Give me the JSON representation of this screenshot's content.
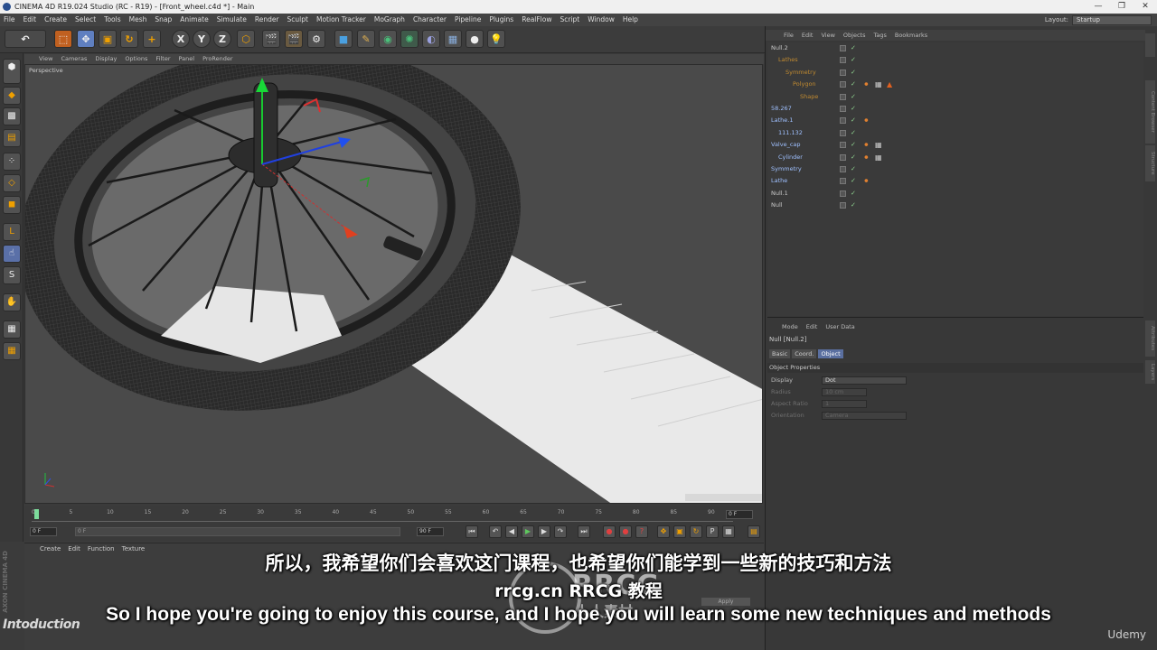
{
  "app": {
    "title": "CINEMA 4D R19.024 Studio (RC - R19) - [Front_wheel.c4d *] - Main",
    "window_controls": [
      "—",
      "❐",
      "✕"
    ]
  },
  "menubar": {
    "items": [
      "File",
      "Edit",
      "Create",
      "Select",
      "Tools",
      "Mesh",
      "Snap",
      "Animate",
      "Simulate",
      "Render",
      "Sculpt",
      "Motion Tracker",
      "MoGraph",
      "Character",
      "Pipeline",
      "Plugins",
      "RealFlow",
      "Script",
      "Window",
      "Help"
    ],
    "layout_label": "Layout:",
    "layout_value": "Startup"
  },
  "toolbar": {
    "axis_x": "X",
    "axis_y": "Y",
    "axis_z": "Z"
  },
  "viewport": {
    "menu": [
      "View",
      "Cameras",
      "Display",
      "Options",
      "Filter",
      "Panel",
      "ProRender"
    ],
    "label": "Perspective"
  },
  "timeline": {
    "ticks": [
      "0",
      "5",
      "10",
      "15",
      "20",
      "25",
      "30",
      "35",
      "40",
      "45",
      "50",
      "55",
      "60",
      "65",
      "70",
      "75",
      "80",
      "85",
      "90"
    ],
    "current_frame": "0 F",
    "start_field": "0 F",
    "end_field": "90 F",
    "range_end": "90 F",
    "range_start": "0 F"
  },
  "material_manager": {
    "menu": [
      "Create",
      "Edit",
      "Function",
      "Texture"
    ],
    "apply": "Apply"
  },
  "side_logo": "AXON CINEMA 4D",
  "intro_label": "Intoduction",
  "object_manager": {
    "menu": [
      "File",
      "Edit",
      "View",
      "Objects",
      "Tags",
      "Bookmarks"
    ],
    "objects": [
      {
        "name": "Null.2"
      },
      {
        "name": "Lathes"
      },
      {
        "name": "Symmetry"
      },
      {
        "name": "Polygon"
      },
      {
        "name": "Shape"
      },
      {
        "name": "58.267"
      },
      {
        "name": "Lathe.1"
      },
      {
        "name": "111.132"
      },
      {
        "name": "Valve_cap"
      },
      {
        "name": "Cylinder"
      },
      {
        "name": "Symmetry"
      },
      {
        "name": "Lathe"
      },
      {
        "name": "Null.1"
      },
      {
        "name": "Null"
      }
    ]
  },
  "attributes": {
    "menu": [
      "Mode",
      "Edit",
      "User Data"
    ],
    "title": "Null [Null.2]",
    "tabs": [
      "Basic",
      "Coord.",
      "Object"
    ],
    "section": "Object Properties",
    "props": [
      {
        "label": "Display",
        "value": "Dot"
      },
      {
        "label": "Radius",
        "value": "10 cm"
      },
      {
        "label": "Aspect Ratio",
        "value": "1"
      },
      {
        "label": "Orientation",
        "value": "Camera"
      }
    ],
    "side_tabs": [
      "Attributes",
      "Layers"
    ]
  },
  "right_side_tabs": [
    "Content Browser",
    "Structure"
  ],
  "subtitles": {
    "cn": "所以，我希望你们会喜欢这门课程，也希望你们能学到一些新的技巧和方法",
    "mid": "rrcg.cn RRCG 教程",
    "en": "So I hope you're going to enjoy this course, and I hope you will learn some new techniques and methods"
  },
  "watermark": {
    "text": "RRCG",
    "sub": "人人素材"
  },
  "brand": "Udemy"
}
